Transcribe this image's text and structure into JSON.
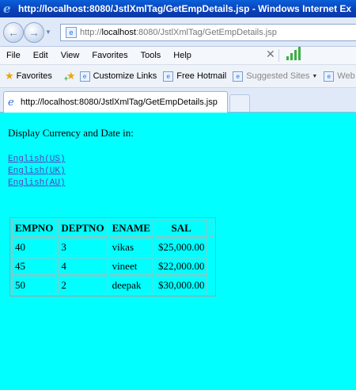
{
  "window": {
    "title": "http://localhost:8080/JstlXmlTag/GetEmpDetails.jsp - Windows Internet Ex"
  },
  "address": {
    "prefix": "http://",
    "host": "localhost",
    "path": ":8080/JstlXmlTag/GetEmpDetails.jsp"
  },
  "menu": [
    "File",
    "Edit",
    "View",
    "Favorites",
    "Tools",
    "Help"
  ],
  "favorites": {
    "label": "Favorites",
    "links": [
      {
        "label": "Customize Links",
        "dim": false
      },
      {
        "label": "Free Hotmail",
        "dim": false
      },
      {
        "label": "Suggested Sites",
        "dim": true,
        "dropdown": true
      },
      {
        "label": "Web Sli",
        "dim": true
      }
    ]
  },
  "tab": {
    "label": "http://localhost:8080/JstlXmlTag/GetEmpDetails.jsp"
  },
  "page": {
    "prompt": "Display Currency and Date in:",
    "locale_links": [
      "English(US)",
      "English(UK)",
      "English(AU)"
    ],
    "table": {
      "headers": [
        "EMPNO",
        "DEPTNO",
        "ENAME",
        "SAL"
      ],
      "rows": [
        [
          "40",
          "3",
          "vikas",
          "$25,000.00"
        ],
        [
          "45",
          "4",
          "vineet",
          "$22,000.00"
        ],
        [
          "50",
          "2",
          "deepak",
          "$30,000.00"
        ]
      ]
    }
  },
  "icons": {
    "back": "back-arrow-icon",
    "forward": "forward-arrow-icon",
    "ie": "ie-logo-icon",
    "close": "close-icon",
    "signal": "signal-bars-icon"
  },
  "colors": {
    "page_background": "#00ffff",
    "titlebar": "#0a4fc8",
    "link": "#5a3fc0"
  }
}
